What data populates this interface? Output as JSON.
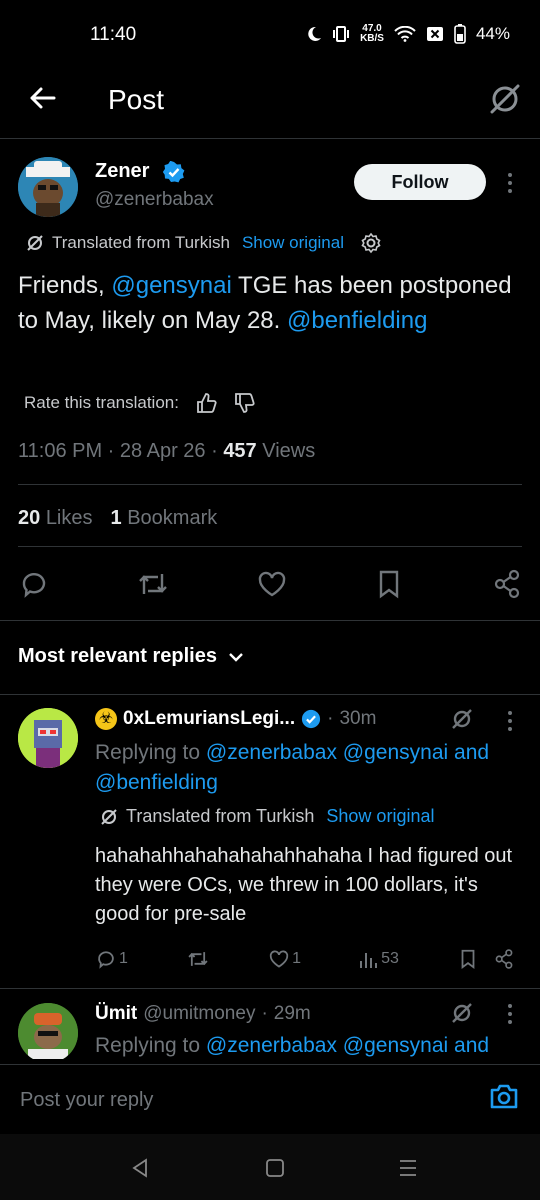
{
  "status_bar": {
    "time": "11:40",
    "net_speed_top": "47.0",
    "net_speed_unit": "KB/S",
    "battery": "44%"
  },
  "header": {
    "title": "Post"
  },
  "post": {
    "author_name": "Zener",
    "author_handle": "@zenerbabax",
    "follow_label": "Follow",
    "translated_label": "Translated from Turkish",
    "show_original": "Show original",
    "text_parts": [
      "Friends, ",
      "@gensynai",
      " TGE has been postponed to May, likely on May 28. ",
      "@benfielding"
    ],
    "rate_translation": "Rate this translation:",
    "time": "11:06 PM",
    "date": "28 Apr 26",
    "views_count": "457",
    "views_label": "Views",
    "likes_count": "20",
    "likes_label": "Likes",
    "bookmarks_count": "1",
    "bookmarks_label": "Bookmark"
  },
  "replies_sort": "Most relevant replies",
  "replies": [
    {
      "name": "0xLemuriansLegi...",
      "time": "30m",
      "replying_label": "Replying to",
      "replying_mentions": "@zenerbabax @gensynai",
      "and_label": "and",
      "replying_mention2": "@benfielding",
      "translated_label": "Translated from Turkish",
      "show_original": "Show original",
      "text": "hahahahhahahahahahhahaha I had figured out they were OCs, we threw in 100 dollars, it's good for pre-sale",
      "reply_count": "1",
      "like_count": "1",
      "views_count": "53"
    },
    {
      "name": "Ümit",
      "handle": "@umitmoney",
      "time": "29m",
      "replying_label": "Replying to",
      "replying_mentions": "@zenerbabax @gensynai",
      "and_label": "and"
    }
  ],
  "reply_input": {
    "placeholder": "Post your reply"
  },
  "colors": {
    "accent": "#1d9bf0",
    "background": "#000000",
    "text": "#e7e9ea",
    "muted": "#71767b",
    "verified": "#1d9bf0"
  }
}
